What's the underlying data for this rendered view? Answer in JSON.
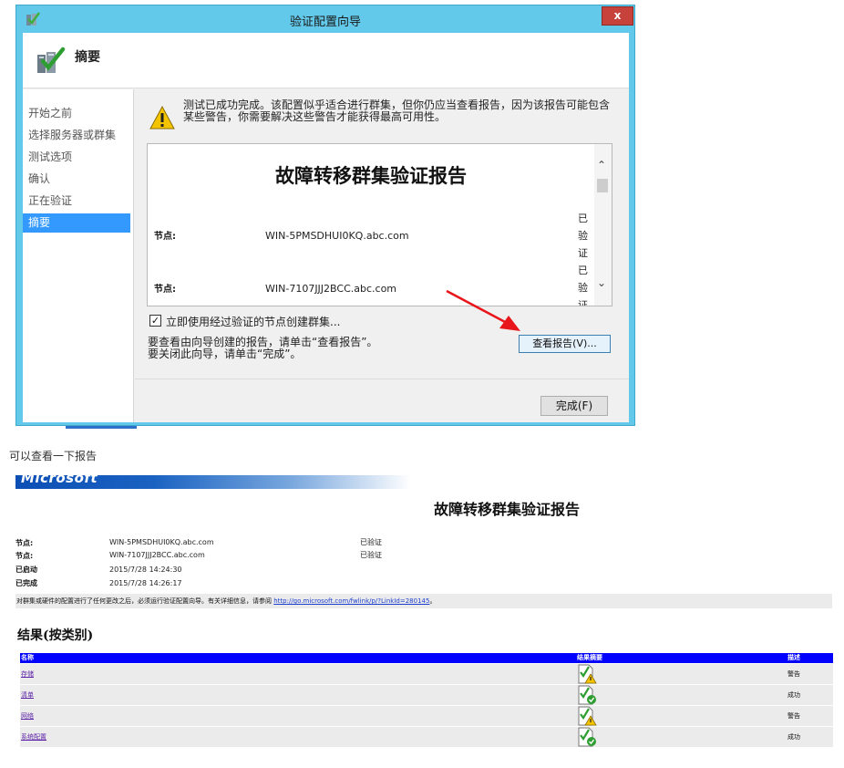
{
  "wizard": {
    "title": "验证配置向导",
    "close_label": "x",
    "header_title": "摘要",
    "nav": [
      {
        "label": "开始之前",
        "active": false
      },
      {
        "label": "选择服务器或群集",
        "active": false
      },
      {
        "label": "测试选项",
        "active": false
      },
      {
        "label": "确认",
        "active": false
      },
      {
        "label": "正在验证",
        "active": false
      },
      {
        "label": "摘要",
        "active": true
      }
    ],
    "warning_line1": "测试已成功完成。该配置似乎适合进行群集，但你仍应当查看报告，因为该报告可能包含",
    "warning_line2": "某些警告，你需要解决这些警告才能获得最高可用性。",
    "report_preview": {
      "title": "故障转移群集验证报告",
      "rows": [
        {
          "label": "节点:",
          "value": "WIN-5PMSDHUI0KQ.abc.com",
          "status": "已验证"
        },
        {
          "label": "节点:",
          "value": "WIN-7107JJJ2BCC.abc.com",
          "status": "已验证"
        }
      ],
      "scroll_up": "⌃",
      "scroll_down": "⌄"
    },
    "checkbox_checked_glyph": "✓",
    "checkbox_label": "立即使用经过验证的节点创建群集...",
    "info_line1": "要查看由向导创建的报告，请单击“查看报告”。",
    "info_line2": "要关闭此向导，请单击“完成”。",
    "view_report_button": "查看报告(V)...",
    "finish_button": "完成(F)"
  },
  "caption": "可以查看一下报告",
  "report": {
    "logo_text": "Microsoft",
    "title": "故障转移群集验证报告",
    "rows": [
      {
        "label": "节点:",
        "value": "WIN-5PMSDHUI0KQ.abc.com",
        "status": "已验证"
      },
      {
        "label": "节点:",
        "value": "WIN-7107JJJ2BCC.abc.com",
        "status": "已验证"
      },
      {
        "label": "已启动",
        "value": "2015/7/28 14:24:30",
        "status": ""
      },
      {
        "label": "已完成",
        "value": "2015/7/28 14:26:17",
        "status": ""
      }
    ],
    "note_text": "对群集或硬件的配置进行了任何更改之后，必须运行验证配置向导。有关详细信息，请参阅 ",
    "note_link": "http://go.microsoft.com/fwlink/p/?LinkId=280145",
    "note_end": "。",
    "results_heading": "结果(按类别)",
    "table_headers": {
      "name": "名称",
      "summary": "结果摘要",
      "description": "描述"
    },
    "results": [
      {
        "name": "存储",
        "icon": "warning-icon",
        "description": "警告"
      },
      {
        "name": "清单",
        "icon": "success-icon",
        "description": "成功"
      },
      {
        "name": "网络",
        "icon": "warning-icon",
        "description": "警告"
      },
      {
        "name": "系统配置",
        "icon": "success-icon",
        "description": "成功"
      }
    ]
  },
  "colors": {
    "title_bar": "#62c9ea",
    "close_button": "#c7423a",
    "nav_active": "#3399ff",
    "table_header": "#0000ff",
    "link": "#1c3fd0",
    "annotation_arrow": "#e8161a"
  }
}
